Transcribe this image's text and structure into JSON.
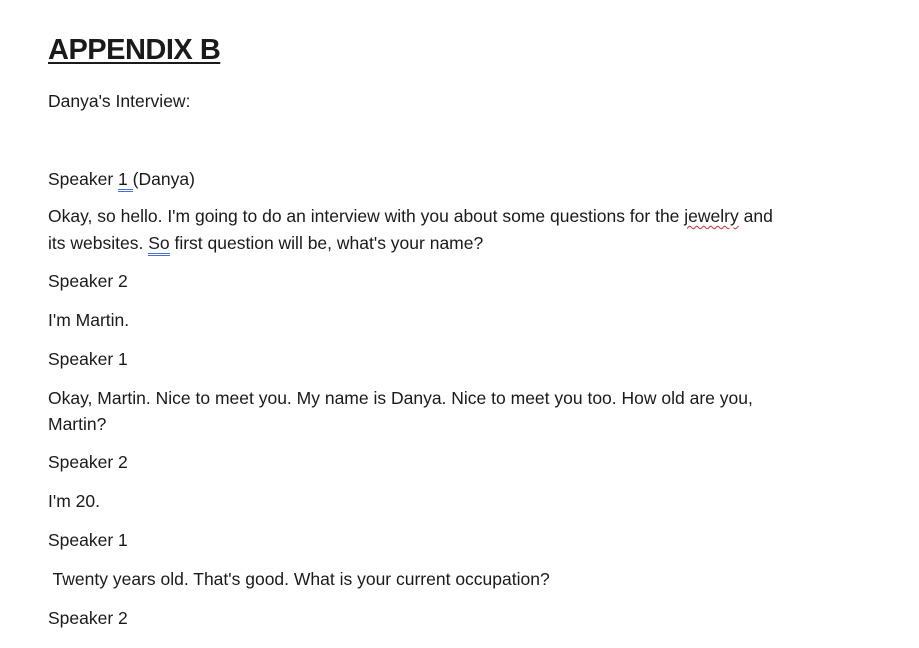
{
  "heading": "APPENDIX B",
  "subtitle": "Danya's Interview:",
  "speaker1_label_a": "Speaker ",
  "speaker1_label_num": "1 ",
  "speaker1_label_b": "(Danya)",
  "p1_a": "Okay, so hello. I'm going to do an interview with you about some questions for the ",
  "p1_jewelry": "jewelry",
  "p1_b": " and",
  "p1_line2_a": "its websites. ",
  "p1_so": "So",
  "p1_line2_b": " first question will be, what's your name?",
  "speaker2_a": "Speaker 2",
  "answer1": "I'm Martin.",
  "speaker1_b": "Speaker 1",
  "p2_line1": "Okay, Martin. Nice to meet you. My name is Danya. Nice to meet you too. How old are you,",
  "p2_line2": "Martin?",
  "speaker2_b": "Speaker 2",
  "answer2": "I'm 20.",
  "speaker1_c": "Speaker 1",
  "p3": " Twenty years old. That's good. What is your current occupation?",
  "speaker2_c": "Speaker 2"
}
